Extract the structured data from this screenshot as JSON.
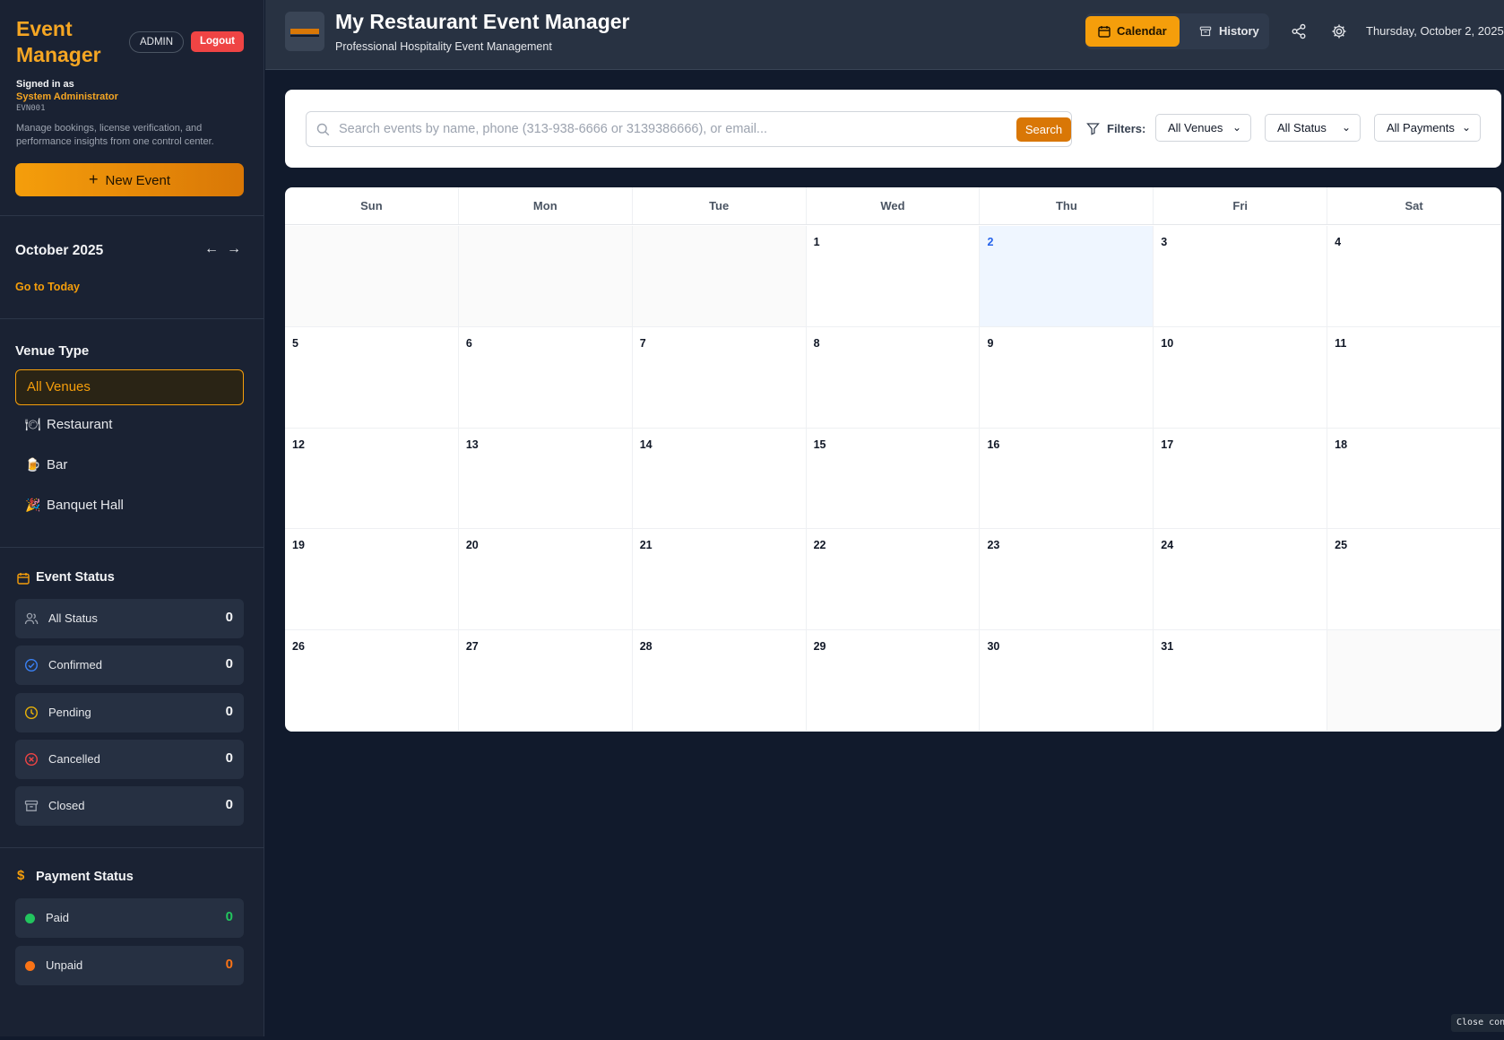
{
  "sidebar": {
    "app_title": "Event Manager",
    "admin_badge": "ADMIN",
    "logout_label": "Logout",
    "signed_in_label": "Signed in as",
    "user_name": "System Administrator",
    "user_code": "EVN001",
    "description": "Manage bookings, license verification, and performance insights from one control center.",
    "new_event_label": "New Event",
    "month_label": "October 2025",
    "go_today_label": "Go to Today",
    "venue_section_title": "Venue Type",
    "venue_items": [
      {
        "label": "All Venues",
        "icon": "🍽"
      },
      {
        "label": "Restaurant",
        "icon": "🍽"
      },
      {
        "label": "Bar",
        "icon": "🍺"
      },
      {
        "label": "Banquet Hall",
        "icon": "🎉"
      }
    ],
    "event_status_title": "Event Status",
    "event_status": [
      {
        "label": "All Status",
        "count": "0",
        "icon": "users-icon"
      },
      {
        "label": "Confirmed",
        "count": "0",
        "icon": "check-circle-icon"
      },
      {
        "label": "Pending",
        "count": "0",
        "icon": "clock-icon"
      },
      {
        "label": "Cancelled",
        "count": "0",
        "icon": "x-circle-icon"
      },
      {
        "label": "Closed",
        "count": "0",
        "icon": "archive-icon"
      }
    ],
    "payment_status_title": "Payment Status",
    "payment_status": [
      {
        "label": "Paid",
        "count": "0",
        "color": "#22c55e"
      },
      {
        "label": "Unpaid",
        "count": "0",
        "color": "#f97316"
      }
    ]
  },
  "header": {
    "title": "My Restaurant Event Manager",
    "subtitle": "Professional Hospitality Event Management",
    "calendar_label": "Calendar",
    "history_label": "History",
    "date": "Thursday, October 2, 2025"
  },
  "search": {
    "placeholder": "Search events by name, phone (313-938-6666 or 3139386666), or email...",
    "button_label": "Search",
    "filters_label": "Filters:",
    "venue_filter": "All Venues",
    "status_filter": "All Status",
    "payment_filter": "All Payments"
  },
  "calendar": {
    "weekdays": [
      "Sun",
      "Mon",
      "Tue",
      "Wed",
      "Thu",
      "Fri",
      "Sat"
    ],
    "days": [
      "",
      "",
      "",
      "1",
      "2",
      "3",
      "4",
      "5",
      "6",
      "7",
      "8",
      "9",
      "10",
      "11",
      "12",
      "13",
      "14",
      "15",
      "16",
      "17",
      "18",
      "19",
      "20",
      "21",
      "22",
      "23",
      "24",
      "25",
      "26",
      "27",
      "28",
      "29",
      "30",
      "31",
      ""
    ],
    "today": "2"
  },
  "footer": {
    "close_label": "Close con"
  },
  "colors": {
    "accent": "#f59e0b",
    "background": "#111a2c",
    "sidebar": "#1a2233"
  }
}
